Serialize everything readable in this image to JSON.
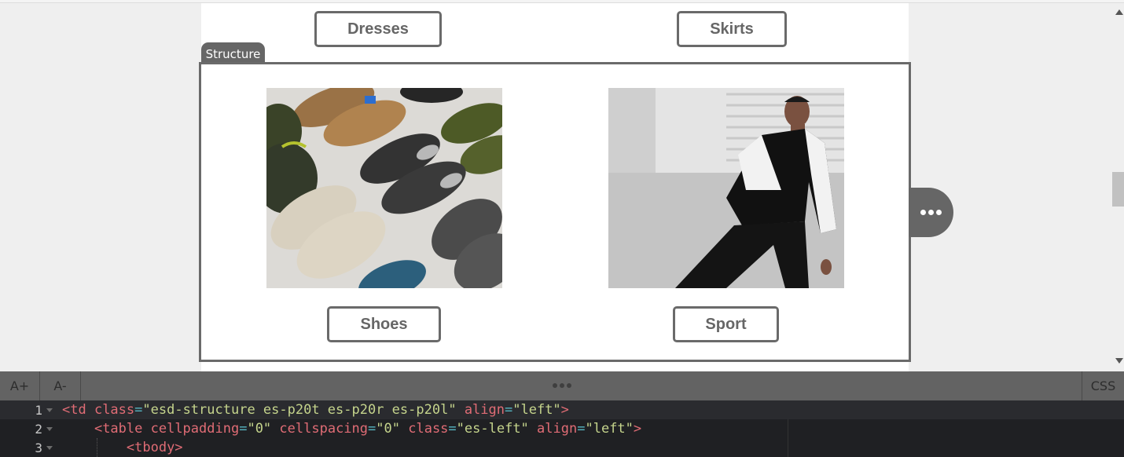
{
  "canvas": {
    "top_buttons": [
      {
        "label": "Dresses"
      },
      {
        "label": "Skirts"
      }
    ],
    "structure_label": "Structure",
    "products": [
      {
        "image_alt": "Assorted sneakers and hiking shoes",
        "label": "Shoes"
      },
      {
        "image_alt": "Man in black and white sport track suit",
        "label": "Sport"
      }
    ],
    "more_button_icon": "more-horizontal-icon"
  },
  "toolbar": {
    "font_increase_label": "A+",
    "font_decrease_label": "A-",
    "resize_handle_icon": "drag-handle-icon",
    "css_label": "CSS"
  },
  "editor": {
    "lines": [
      {
        "number": "1"
      },
      {
        "number": "2"
      },
      {
        "number": "3"
      }
    ],
    "line1": {
      "t1": "<td ",
      "a1": "class",
      "e1": "=",
      "s1": "\"esd-structure es-p20t es-p20r es-p20l\"",
      "sp": " ",
      "a2": "align",
      "e2": "=",
      "s2": "\"left\"",
      "t2": ">"
    },
    "line2": {
      "indent": "    ",
      "t1": "<table ",
      "a1": "cellpadding",
      "e1": "=",
      "s1": "\"0\"",
      "sp1": " ",
      "a2": "cellspacing",
      "e2": "=",
      "s2": "\"0\"",
      "sp2": " ",
      "a3": "class",
      "e3": "=",
      "s3": "\"es-left\"",
      "sp3": " ",
      "a4": "align",
      "e4": "=",
      "s4": "\"left\"",
      "t2": ">"
    },
    "line3": {
      "indent": "        ",
      "t1": "<tbody>"
    }
  }
}
